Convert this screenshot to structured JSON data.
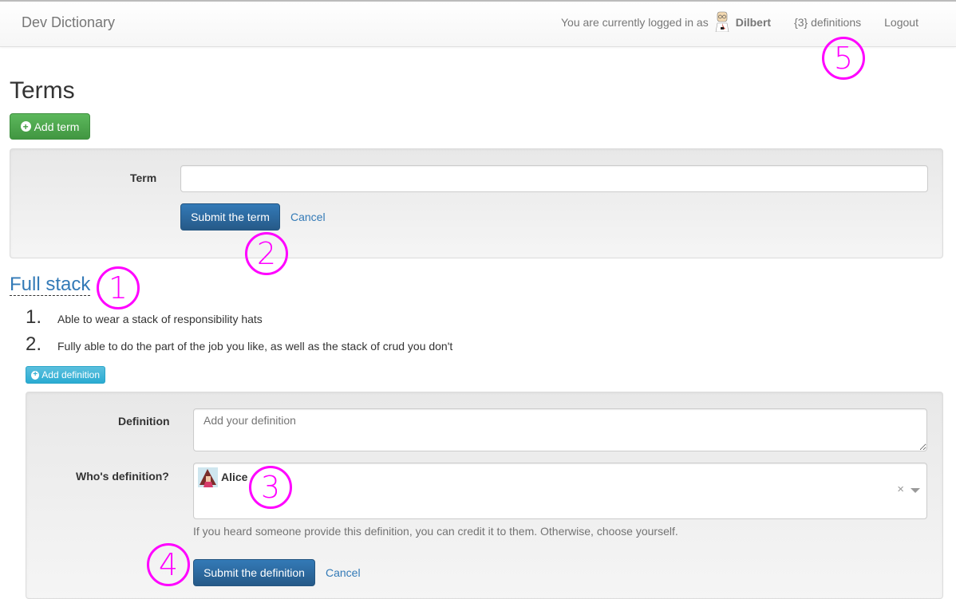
{
  "navbar": {
    "brand": "Dev Dictionary",
    "logged_in_text": "You are currently logged in as",
    "user_name": "Dilbert",
    "user_avatar_icon": "dilbert-avatar",
    "definitions_link": "{3} definitions",
    "logout_link": "Logout"
  },
  "page": {
    "title": "Terms",
    "add_term_button": "Add term"
  },
  "term_form": {
    "label": "Term",
    "value": "",
    "placeholder": "",
    "submit_button": "Submit the term",
    "cancel_link": "Cancel"
  },
  "term": {
    "name": "Full stack",
    "definitions": [
      {
        "number": "1.",
        "text": "Able to wear a stack of responsibility hats"
      },
      {
        "number": "2.",
        "text": "Fully able to do the part of the job you like, as well as the stack of crud you don't"
      }
    ],
    "add_definition_button": "Add definition"
  },
  "definition_form": {
    "definition_label": "Definition",
    "definition_placeholder": "Add your definition",
    "definition_value": "",
    "who_label": "Who's definition?",
    "who_selected": "Alice",
    "who_avatar_icon": "alice-avatar",
    "clear_icon": "×",
    "help_text": "If you heard someone provide this definition, you can credit it to them. Otherwise, choose yourself.",
    "submit_button": "Submit the definition",
    "cancel_link": "Cancel"
  },
  "annotations": {
    "marker_1": "1",
    "marker_2": "2",
    "marker_3": "3",
    "marker_4": "4",
    "marker_5": "5",
    "color": "#ff00ff"
  },
  "colors": {
    "link": "#337ab7",
    "success": "#5cb85c",
    "primary": "#337ab7",
    "info": "#5bc0de"
  }
}
